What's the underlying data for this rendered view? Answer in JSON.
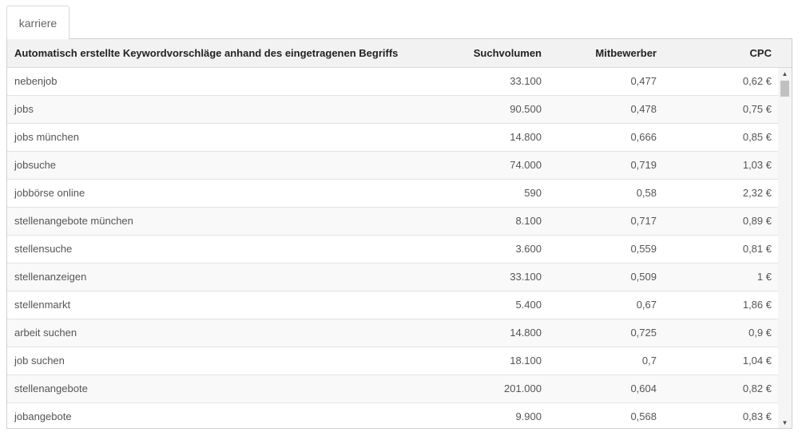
{
  "tab": {
    "label": "karriere"
  },
  "table": {
    "headers": {
      "keyword": "Automatisch erstellte Keywordvorschläge anhand des eingetragenen Begriffs",
      "volume": "Suchvolumen",
      "competition": "Mitbewerber",
      "cpc": "CPC"
    },
    "rows": [
      {
        "keyword": "nebenjob",
        "volume": "33.100",
        "competition": "0,477",
        "cpc": "0,62 €"
      },
      {
        "keyword": "jobs",
        "volume": "90.500",
        "competition": "0,478",
        "cpc": "0,75 €"
      },
      {
        "keyword": "jobs münchen",
        "volume": "14.800",
        "competition": "0,666",
        "cpc": "0,85 €"
      },
      {
        "keyword": "jobsuche",
        "volume": "74.000",
        "competition": "0,719",
        "cpc": "1,03 €"
      },
      {
        "keyword": "jobbörse online",
        "volume": "590",
        "competition": "0,58",
        "cpc": "2,32 €"
      },
      {
        "keyword": "stellenangebote münchen",
        "volume": "8.100",
        "competition": "0,717",
        "cpc": "0,89 €"
      },
      {
        "keyword": "stellensuche",
        "volume": "3.600",
        "competition": "0,559",
        "cpc": "0,81 €"
      },
      {
        "keyword": "stellenanzeigen",
        "volume": "33.100",
        "competition": "0,509",
        "cpc": "1 €"
      },
      {
        "keyword": "stellenmarkt",
        "volume": "5.400",
        "competition": "0,67",
        "cpc": "1,86 €"
      },
      {
        "keyword": "arbeit suchen",
        "volume": "14.800",
        "competition": "0,725",
        "cpc": "0,9 €"
      },
      {
        "keyword": "job suchen",
        "volume": "18.100",
        "competition": "0,7",
        "cpc": "1,04 €"
      },
      {
        "keyword": "stellenangebote",
        "volume": "201.000",
        "competition": "0,604",
        "cpc": "0,82 €"
      },
      {
        "keyword": "jobangebote",
        "volume": "9.900",
        "competition": "0,568",
        "cpc": "0,83 €"
      }
    ]
  },
  "scrollbar": {
    "up_icon": "arrow-up-icon",
    "down_icon": "arrow-down-icon"
  }
}
